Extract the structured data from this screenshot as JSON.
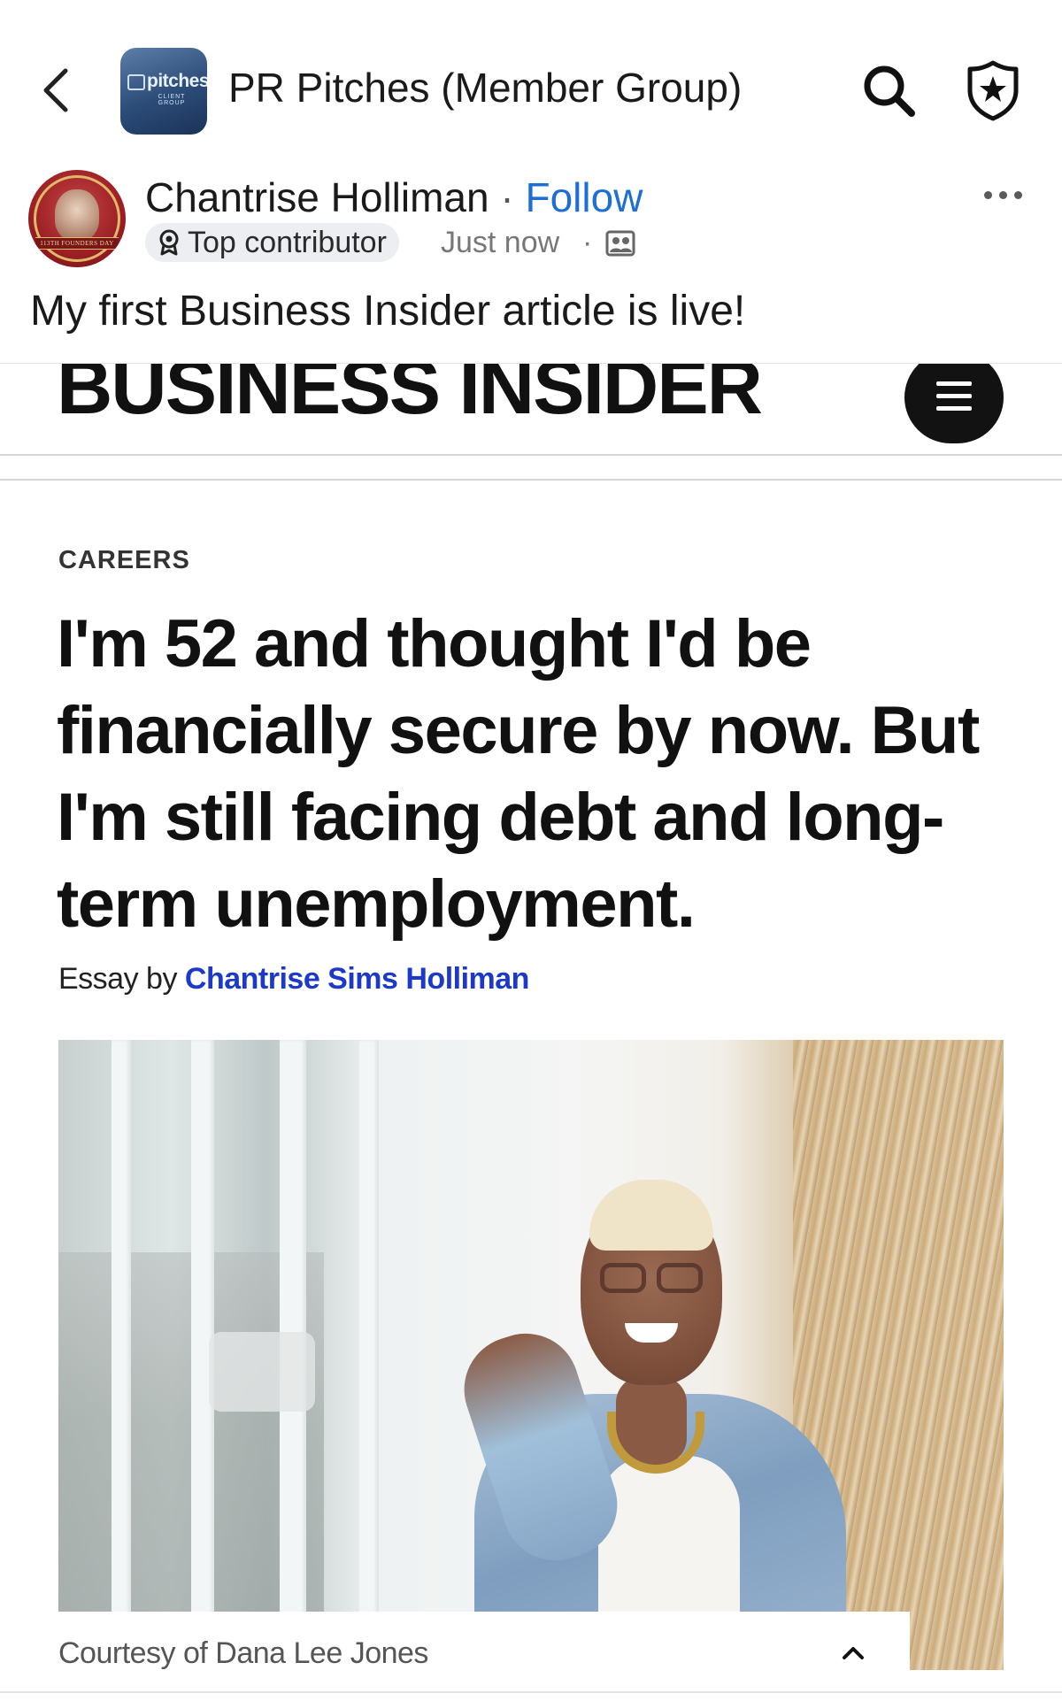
{
  "header": {
    "group_name": "PR Pitches (Member Group)",
    "group_logo_text": "pitches",
    "group_logo_subtext": "CLIENT GROUP",
    "icons": {
      "back": "chevron-left-icon",
      "search": "search-icon",
      "badge": "star-shield-icon"
    }
  },
  "post": {
    "author_name": "Chantrise Holliman",
    "separator": "·",
    "follow_label": "Follow",
    "badge_label": "Top contributor",
    "timestamp": "Just now",
    "meta_separator": "·",
    "text": "My first Business Insider article is live!",
    "avatar_banner": "113TH FOUNDERS DAY"
  },
  "article": {
    "publication": "BUSINESS INSIDER",
    "section": "CAREERS",
    "headline": "I'm 52 and thought I'd be financially secure by now. But I'm still facing debt and long-term unemployment.",
    "byline_prefix": "Essay by",
    "byline_author": "Chantrise Sims Holliman",
    "photo_caption": "Courtesy of Dana Lee Jones"
  },
  "colors": {
    "follow_blue": "#1d6fd6",
    "byline_blue": "#1c39c9",
    "badge_bg": "#eceef1"
  }
}
